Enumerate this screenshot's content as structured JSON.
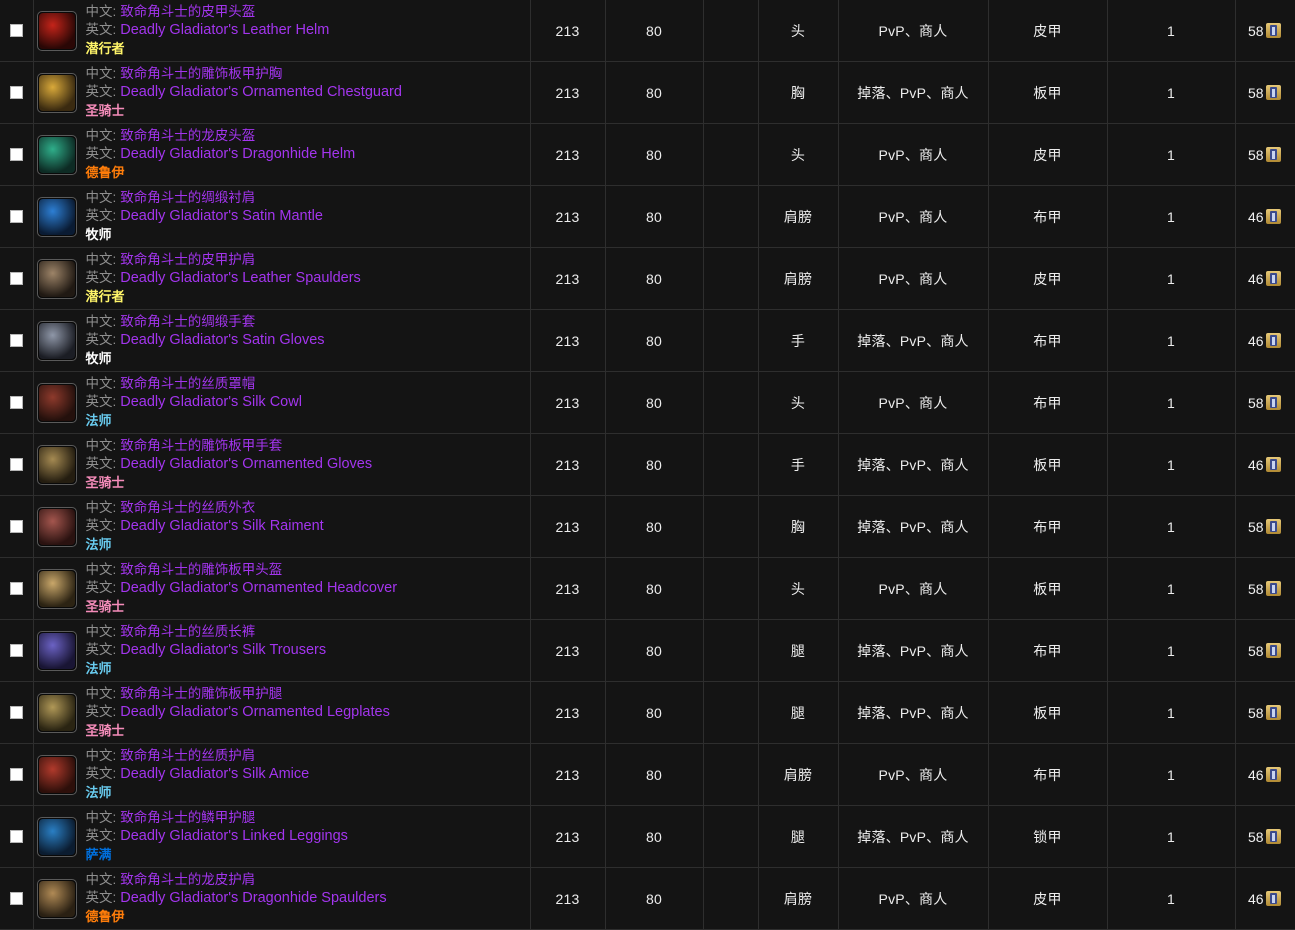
{
  "table": {
    "columns": [
      {
        "key": "checkbox",
        "label": ""
      },
      {
        "key": "item",
        "label": ""
      },
      {
        "key": "item_level",
        "label": ""
      },
      {
        "key": "required_level",
        "label": ""
      },
      {
        "key": "blank",
        "label": ""
      },
      {
        "key": "slot",
        "label": ""
      },
      {
        "key": "source",
        "label": ""
      },
      {
        "key": "armor_type",
        "label": ""
      },
      {
        "key": "count",
        "label": ""
      },
      {
        "key": "price",
        "label": ""
      }
    ],
    "labels": {
      "chinese": "中文:",
      "english": "英文:"
    },
    "class_colors": {
      "潜行者": "#fff569",
      "圣骑士": "#f58cba",
      "德鲁伊": "#ff7d0a",
      "牧师": "#ffffff",
      "法师": "#69ccf0",
      "萨满": "#0070de"
    },
    "icon_names": {
      "checkbox": "row-checkbox",
      "price": "currency-icon"
    },
    "rows": [
      {
        "name_cn": "致命角斗士的皮甲头盔",
        "name_en": "Deadly Gladiator's Leather Helm",
        "class": "潜行者",
        "item_level": "213",
        "required_level": "80",
        "blank": "",
        "slot": "头",
        "source": "PvP、商人",
        "armor_type": "皮甲",
        "count": "1",
        "price": "58",
        "icon_color_a": "#c4241a",
        "icon_color_b": "#2a0705"
      },
      {
        "name_cn": "致命角斗士的雕饰板甲护胸",
        "name_en": "Deadly Gladiator's Ornamented Chestguard",
        "class": "圣骑士",
        "item_level": "213",
        "required_level": "80",
        "blank": "",
        "slot": "胸",
        "source": "掉落、PvP、商人",
        "armor_type": "板甲",
        "count": "1",
        "price": "58",
        "icon_color_a": "#d9a93a",
        "icon_color_b": "#3a2a10"
      },
      {
        "name_cn": "致命角斗士的龙皮头盔",
        "name_en": "Deadly Gladiator's Dragonhide Helm",
        "class": "德鲁伊",
        "item_level": "213",
        "required_level": "80",
        "blank": "",
        "slot": "头",
        "source": "PvP、商人",
        "armor_type": "皮甲",
        "count": "1",
        "price": "58",
        "icon_color_a": "#2fae8a",
        "icon_color_b": "#0d2b24"
      },
      {
        "name_cn": "致命角斗士的绸缎衬肩",
        "name_en": "Deadly Gladiator's Satin Mantle",
        "class": "牧师",
        "item_level": "213",
        "required_level": "80",
        "blank": "",
        "slot": "肩膀",
        "source": "PvP、商人",
        "armor_type": "布甲",
        "count": "1",
        "price": "46",
        "icon_color_a": "#2d7fd4",
        "icon_color_b": "#0a1b33"
      },
      {
        "name_cn": "致命角斗士的皮甲护肩",
        "name_en": "Deadly Gladiator's Leather Spaulders",
        "class": "潜行者",
        "item_level": "213",
        "required_level": "80",
        "blank": "",
        "slot": "肩膀",
        "source": "PvP、商人",
        "armor_type": "皮甲",
        "count": "1",
        "price": "46",
        "icon_color_a": "#9d8468",
        "icon_color_b": "#201913"
      },
      {
        "name_cn": "致命角斗士的绸缎手套",
        "name_en": "Deadly Gladiator's Satin Gloves",
        "class": "牧师",
        "item_level": "213",
        "required_level": "80",
        "blank": "",
        "slot": "手",
        "source": "掉落、PvP、商人",
        "armor_type": "布甲",
        "count": "1",
        "price": "46",
        "icon_color_a": "#8f97a8",
        "icon_color_b": "#1b1d24"
      },
      {
        "name_cn": "致命角斗士的丝质罩帽",
        "name_en": "Deadly Gladiator's Silk Cowl",
        "class": "法师",
        "item_level": "213",
        "required_level": "80",
        "blank": "",
        "slot": "头",
        "source": "PvP、商人",
        "armor_type": "布甲",
        "count": "1",
        "price": "58",
        "icon_color_a": "#8e3a2c",
        "icon_color_b": "#24100c"
      },
      {
        "name_cn": "致命角斗士的雕饰板甲手套",
        "name_en": "Deadly Gladiator's Ornamented Gloves",
        "class": "圣骑士",
        "item_level": "213",
        "required_level": "80",
        "blank": "",
        "slot": "手",
        "source": "掉落、PvP、商人",
        "armor_type": "板甲",
        "count": "1",
        "price": "46",
        "icon_color_a": "#a58a52",
        "icon_color_b": "#241d10"
      },
      {
        "name_cn": "致命角斗士的丝质外衣",
        "name_en": "Deadly Gladiator's Silk Raiment",
        "class": "法师",
        "item_level": "213",
        "required_level": "80",
        "blank": "",
        "slot": "胸",
        "source": "掉落、PvP、商人",
        "armor_type": "布甲",
        "count": "1",
        "price": "58",
        "icon_color_a": "#a4564e",
        "icon_color_b": "#2a1210"
      },
      {
        "name_cn": "致命角斗士的雕饰板甲头盔",
        "name_en": "Deadly Gladiator's Ornamented Headcover",
        "class": "圣骑士",
        "item_level": "213",
        "required_level": "80",
        "blank": "",
        "slot": "头",
        "source": "PvP、商人",
        "armor_type": "板甲",
        "count": "1",
        "price": "58",
        "icon_color_a": "#c9a76a",
        "icon_color_b": "#2c2313"
      },
      {
        "name_cn": "致命角斗士的丝质长裤",
        "name_en": "Deadly Gladiator's Silk Trousers",
        "class": "法师",
        "item_level": "213",
        "required_level": "80",
        "blank": "",
        "slot": "腿",
        "source": "掉落、PvP、商人",
        "armor_type": "布甲",
        "count": "1",
        "price": "58",
        "icon_color_a": "#6b62c4",
        "icon_color_b": "#191534"
      },
      {
        "name_cn": "致命角斗士的雕饰板甲护腿",
        "name_en": "Deadly Gladiator's Ornamented Legplates",
        "class": "圣骑士",
        "item_level": "213",
        "required_level": "80",
        "blank": "",
        "slot": "腿",
        "source": "掉落、PvP、商人",
        "armor_type": "板甲",
        "count": "1",
        "price": "58",
        "icon_color_a": "#b09857",
        "icon_color_b": "#2a2412"
      },
      {
        "name_cn": "致命角斗士的丝质护肩",
        "name_en": "Deadly Gladiator's Silk Amice",
        "class": "法师",
        "item_level": "213",
        "required_level": "80",
        "blank": "",
        "slot": "肩膀",
        "source": "PvP、商人",
        "armor_type": "布甲",
        "count": "1",
        "price": "46",
        "icon_color_a": "#b13a2c",
        "icon_color_b": "#2d0f0a"
      },
      {
        "name_cn": "致命角斗士的鳞甲护腿",
        "name_en": "Deadly Gladiator's Linked Leggings",
        "class": "萨满",
        "item_level": "213",
        "required_level": "80",
        "blank": "",
        "slot": "腿",
        "source": "掉落、PvP、商人",
        "armor_type": "锁甲",
        "count": "1",
        "price": "58",
        "icon_color_a": "#2a7fc4",
        "icon_color_b": "#0b1c30"
      },
      {
        "name_cn": "致命角斗士的龙皮护肩",
        "name_en": "Deadly Gladiator's Dragonhide Spaulders",
        "class": "德鲁伊",
        "item_level": "213",
        "required_level": "80",
        "blank": "",
        "slot": "肩膀",
        "source": "PvP、商人",
        "armor_type": "皮甲",
        "count": "1",
        "price": "46",
        "icon_color_a": "#b08a55",
        "icon_color_b": "#2a2013"
      }
    ]
  }
}
